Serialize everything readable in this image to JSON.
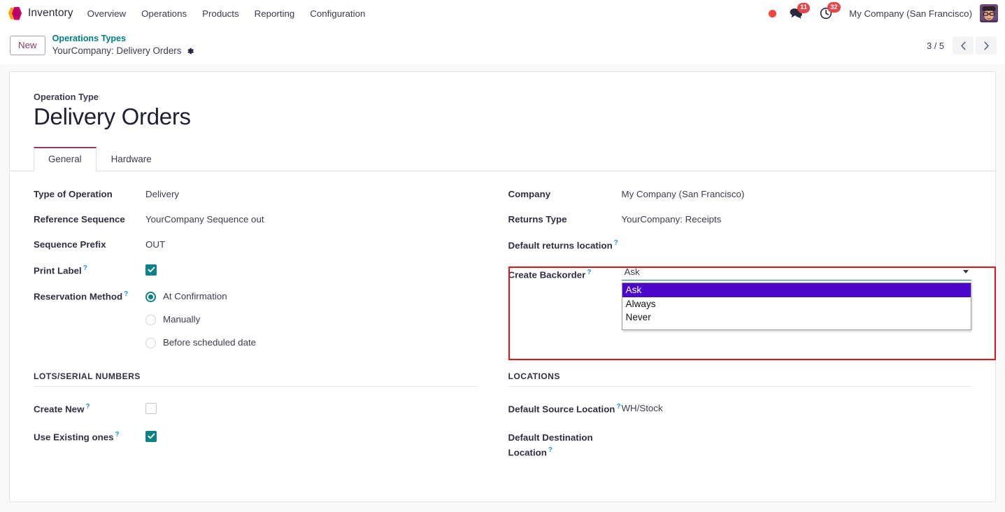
{
  "navbar": {
    "logo_icon": "inventory-cube-icon",
    "app_name": "Inventory",
    "menu": [
      {
        "label": "Overview"
      },
      {
        "label": "Operations"
      },
      {
        "label": "Products"
      },
      {
        "label": "Reporting"
      },
      {
        "label": "Configuration"
      }
    ],
    "recording_dot_icon": "record-dot-icon",
    "messages": {
      "icon": "chat-bubble-icon",
      "badge": "11"
    },
    "activities": {
      "icon": "clock-icon",
      "badge": "32"
    },
    "company": "My Company (San Francisco)",
    "avatar_icon": "user-avatar-icon"
  },
  "control_panel": {
    "new_button": "New",
    "breadcrumb_parent": "Operations Types",
    "breadcrumb_current": "YourCompany: Delivery Orders",
    "settings_icon": "gear-icon",
    "pager": {
      "count": "3 / 5",
      "prev_icon": "chevron-left-icon",
      "next_icon": "chevron-right-icon"
    }
  },
  "record": {
    "subtitle": "Operation Type",
    "title": "Delivery Orders",
    "tabs": [
      {
        "label": "General",
        "active": true
      },
      {
        "label": "Hardware",
        "active": false
      }
    ],
    "left_fields": {
      "type_of_operation": {
        "label": "Type of Operation",
        "value": "Delivery"
      },
      "reference_sequence": {
        "label": "Reference Sequence",
        "value": "YourCompany Sequence out"
      },
      "sequence_prefix": {
        "label": "Sequence Prefix",
        "value": "OUT"
      },
      "print_label": {
        "label": "Print Label",
        "help": "?",
        "checked": true
      },
      "reservation_method": {
        "label": "Reservation Method",
        "help": "?",
        "options": [
          {
            "label": "At Confirmation",
            "selected": true
          },
          {
            "label": "Manually",
            "selected": false
          },
          {
            "label": "Before scheduled date",
            "selected": false
          }
        ]
      }
    },
    "right_fields": {
      "company": {
        "label": "Company",
        "value": "My Company (San Francisco)"
      },
      "returns_type": {
        "label": "Returns Type",
        "value": "YourCompany: Receipts"
      },
      "default_returns_location": {
        "label": "Default returns location",
        "help": "?",
        "value": ""
      },
      "create_backorder": {
        "label": "Create Backorder",
        "help": "?",
        "value": "Ask",
        "expanded": true,
        "options": [
          {
            "label": "Ask",
            "highlighted": true
          },
          {
            "label": "Always",
            "highlighted": false
          },
          {
            "label": "Never",
            "highlighted": false
          }
        ],
        "dropdown_arrow_icon": "caret-down-icon"
      }
    },
    "section_lots": {
      "title": "LOTS/SERIAL NUMBERS",
      "fields": [
        {
          "label": "Create New",
          "help": "?",
          "checked": false
        },
        {
          "label": "Use Existing ones",
          "help": "?",
          "checked": true
        }
      ]
    },
    "section_locations": {
      "title": "LOCATIONS",
      "fields": [
        {
          "label": "Default Source Location",
          "help": "?",
          "value": "WH/Stock"
        },
        {
          "label": "Default Destination Location",
          "help": "?",
          "value": ""
        }
      ]
    }
  },
  "annotation": {
    "color": "#ee1111",
    "target": "create-backorder-dropdown"
  },
  "colors": {
    "accent_teal": "#0e8285",
    "brand_purple": "#883c62",
    "link_teal": "#017e84",
    "badge_red": "#e5464a",
    "select_highlight": "#4b08cc",
    "annotation_red": "#ee1111"
  }
}
